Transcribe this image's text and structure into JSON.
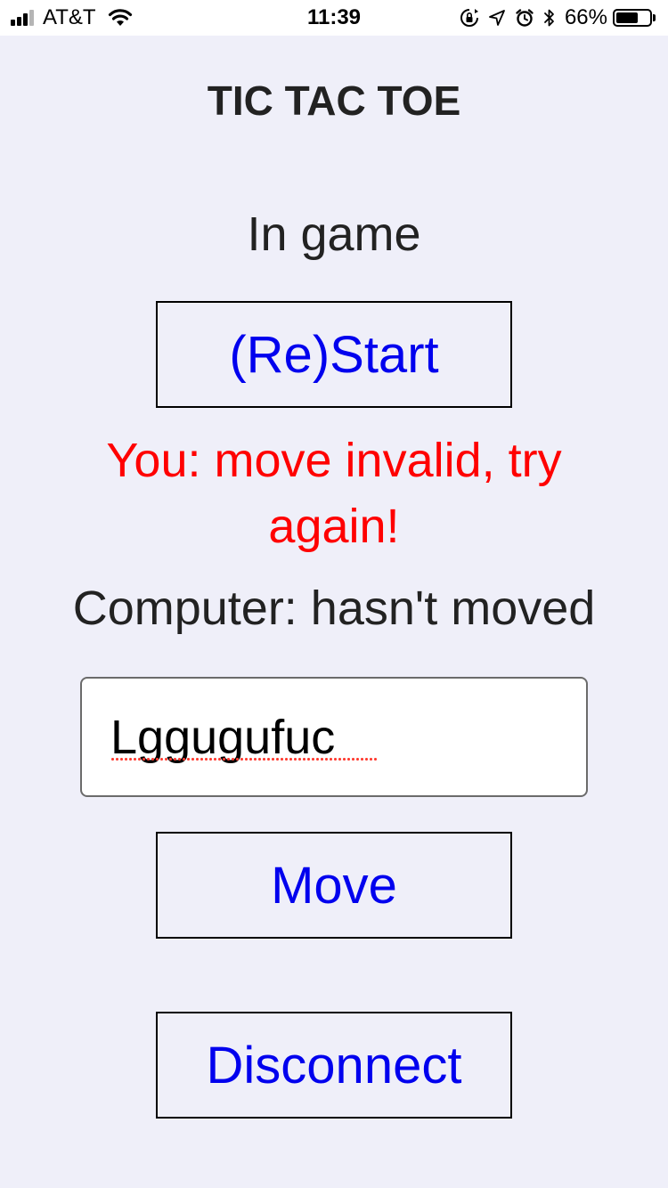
{
  "status_bar": {
    "carrier": "AT&T",
    "signal_bars_filled": 3,
    "signal_bars_total": 4,
    "time": "11:39",
    "icons": [
      "wifi-icon",
      "orientation-lock-icon",
      "location-arrow-icon",
      "alarm-icon",
      "bluetooth-icon",
      "battery-icon"
    ],
    "battery_percent": "66%",
    "battery_level": 0.66
  },
  "app": {
    "title": "TIC TAC TOE",
    "game_state": "In game",
    "restart_label": "(Re)Start",
    "player_message": "You: move invalid, try again!",
    "computer_message": "Computer: hasn't moved",
    "move_input": {
      "value": "Lggugufuc",
      "placeholder": ""
    },
    "move_label": "Move",
    "disconnect_label": "Disconnect"
  },
  "colors": {
    "background": "#efeff9",
    "text": "#222222",
    "button_text": "#0000ee",
    "error_text": "#ff0000",
    "button_border": "#000000"
  }
}
